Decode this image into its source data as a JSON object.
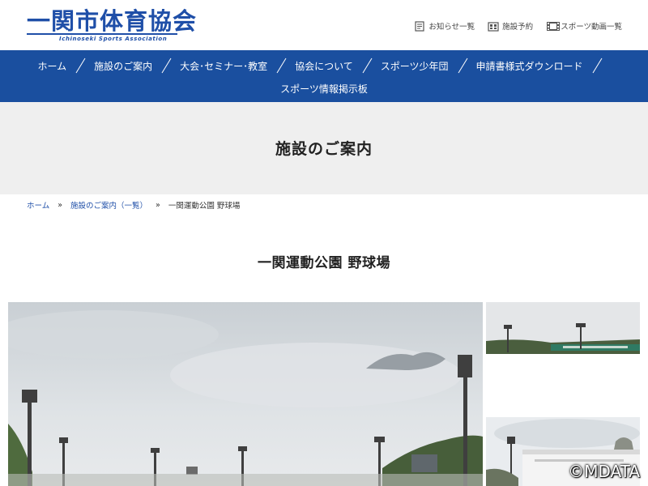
{
  "header": {
    "logo_text": "一関市体育協会",
    "logo_subtext": "Ichinoseki Sports Association",
    "utility_links": [
      {
        "label": "お知らせ一覧",
        "icon": "document-list-icon"
      },
      {
        "label": "施設予約",
        "icon": "facility-booking-icon"
      },
      {
        "label": "スポーツ動画一覧",
        "icon": "video-film-icon"
      }
    ]
  },
  "nav": {
    "row1": [
      "ホーム",
      "施設のご案内",
      "大会･セミナー･教室",
      "協会について",
      "スポーツ少年団",
      "申請書様式ダウンロード"
    ],
    "row2": [
      "スポーツ情報掲示板"
    ]
  },
  "page": {
    "title": "施設のご案内"
  },
  "breadcrumb": {
    "home": "ホーム",
    "separator": "»",
    "parent": "施設のご案内（一覧）",
    "current": "一関運動公園 野球場"
  },
  "facility": {
    "title": "一関運動公園 野球場"
  },
  "watermark": "©MDATA",
  "colors": {
    "brand_blue": "#1a4f9f",
    "logo_blue": "#1f4fa8",
    "title_band": "#efefef",
    "link": "#1f4fa8"
  }
}
